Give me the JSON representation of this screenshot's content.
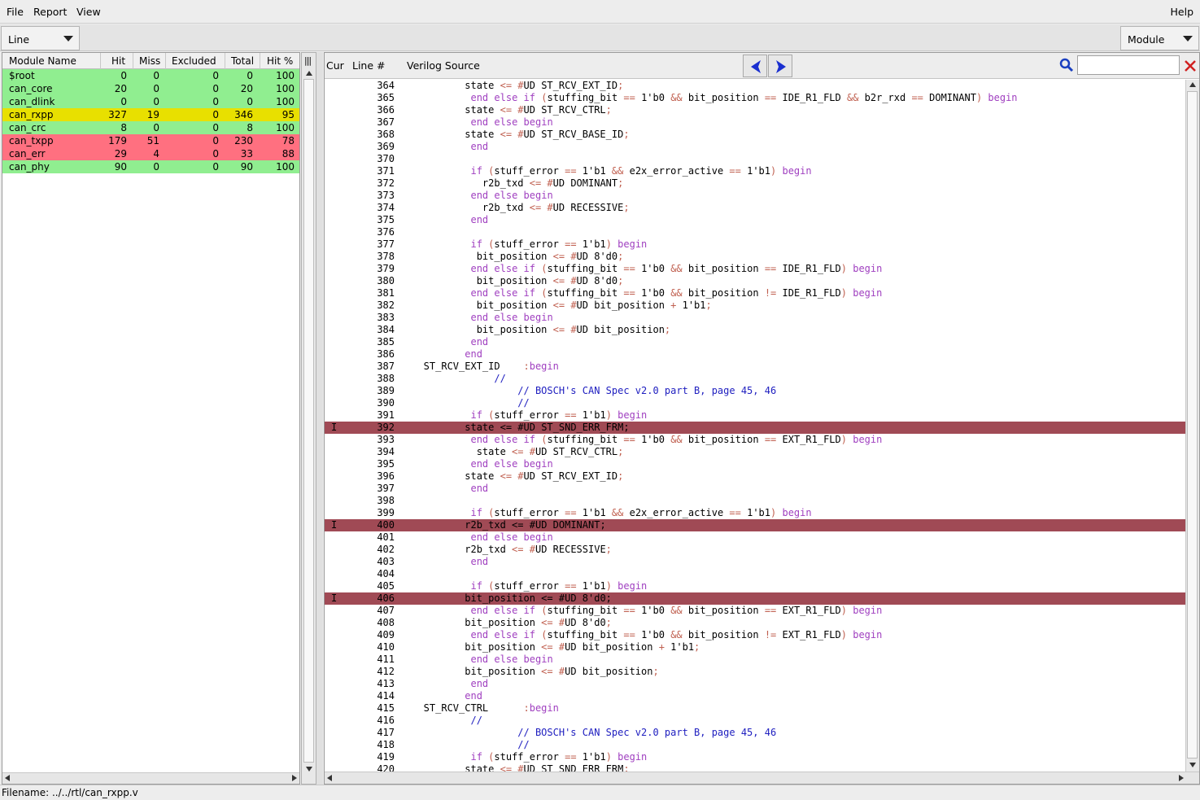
{
  "menu": {
    "file": "File",
    "report": "Report",
    "view": "View",
    "help": "Help"
  },
  "toolbar": {
    "coverage_type": "Line",
    "scope": "Module"
  },
  "module_table": {
    "columns": [
      "Module Name",
      "Hit",
      "Miss",
      "Excluded",
      "Total",
      "Hit %"
    ],
    "colors": {
      "full": "#90ee90",
      "partial": "#e8e000",
      "low": "#ff7080"
    },
    "rows": [
      {
        "name": "$root",
        "hit": "0",
        "miss": "0",
        "excluded": "0",
        "total": "0",
        "pct": "100",
        "status": "full"
      },
      {
        "name": "can_core",
        "hit": "20",
        "miss": "0",
        "excluded": "0",
        "total": "20",
        "pct": "100",
        "status": "full"
      },
      {
        "name": "can_dlink",
        "hit": "0",
        "miss": "0",
        "excluded": "0",
        "total": "0",
        "pct": "100",
        "status": "full"
      },
      {
        "name": "can_rxpp",
        "hit": "327",
        "miss": "19",
        "excluded": "0",
        "total": "346",
        "pct": "95",
        "status": "partial"
      },
      {
        "name": "can_crc",
        "hit": "8",
        "miss": "0",
        "excluded": "0",
        "total": "8",
        "pct": "100",
        "status": "full"
      },
      {
        "name": "can_txpp",
        "hit": "179",
        "miss": "51",
        "excluded": "0",
        "total": "230",
        "pct": "78",
        "status": "low"
      },
      {
        "name": "can_err",
        "hit": "29",
        "miss": "4",
        "excluded": "0",
        "total": "33",
        "pct": "88",
        "status": "low"
      },
      {
        "name": "can_phy",
        "hit": "90",
        "miss": "0",
        "excluded": "0",
        "total": "90",
        "pct": "100",
        "status": "full"
      }
    ]
  },
  "source": {
    "headers": {
      "cur": "Cur",
      "line": "Line #",
      "source": "Verilog Source"
    },
    "miss_color": "#a04a55",
    "lines": [
      {
        "n": "364",
        "code": "          state <= #UD ST_RCV_EXT_ID;"
      },
      {
        "n": "365",
        "code": "           end else if (stuffing_bit == 1'b0 && bit_position == IDE_R1_FLD && b2r_rxd == DOMINANT) begin"
      },
      {
        "n": "366",
        "code": "          state <= #UD ST_RCV_CTRL;"
      },
      {
        "n": "367",
        "code": "           end else begin"
      },
      {
        "n": "368",
        "code": "          state <= #UD ST_RCV_BASE_ID;"
      },
      {
        "n": "369",
        "code": "           end"
      },
      {
        "n": "370",
        "code": ""
      },
      {
        "n": "371",
        "code": "           if (stuff_error == 1'b1 && e2x_error_active == 1'b1) begin"
      },
      {
        "n": "372",
        "code": "             r2b_txd <= #UD DOMINANT;"
      },
      {
        "n": "373",
        "code": "           end else begin"
      },
      {
        "n": "374",
        "code": "             r2b_txd <= #UD RECESSIVE;"
      },
      {
        "n": "375",
        "code": "           end"
      },
      {
        "n": "376",
        "code": ""
      },
      {
        "n": "377",
        "code": "           if (stuff_error == 1'b1) begin"
      },
      {
        "n": "378",
        "code": "            bit_position <= #UD 8'd0;"
      },
      {
        "n": "379",
        "code": "           end else if (stuffing_bit == 1'b0 && bit_position == IDE_R1_FLD) begin"
      },
      {
        "n": "380",
        "code": "            bit_position <= #UD 8'd0;"
      },
      {
        "n": "381",
        "code": "           end else if (stuffing_bit == 1'b0 && bit_position != IDE_R1_FLD) begin"
      },
      {
        "n": "382",
        "code": "            bit_position <= #UD bit_position + 1'b1;"
      },
      {
        "n": "383",
        "code": "           end else begin"
      },
      {
        "n": "384",
        "code": "            bit_position <= #UD bit_position;"
      },
      {
        "n": "385",
        "code": "           end"
      },
      {
        "n": "386",
        "code": "          end"
      },
      {
        "n": "387",
        "code": "   ST_RCV_EXT_ID    :begin"
      },
      {
        "n": "388",
        "code": "               //"
      },
      {
        "n": "389",
        "code": "                   // BOSCH's CAN Spec v2.0 part B, page 45, 46"
      },
      {
        "n": "390",
        "code": "                   //"
      },
      {
        "n": "391",
        "code": "           if (stuff_error == 1'b1) begin"
      },
      {
        "n": "392",
        "code": "          state <= #UD ST_SND_ERR_FRM;",
        "cur": "I",
        "miss": true
      },
      {
        "n": "393",
        "code": "           end else if (stuffing_bit == 1'b0 && bit_position == EXT_R1_FLD) begin"
      },
      {
        "n": "394",
        "code": "            state <= #UD ST_RCV_CTRL;"
      },
      {
        "n": "395",
        "code": "           end else begin"
      },
      {
        "n": "396",
        "code": "          state <= #UD ST_RCV_EXT_ID;"
      },
      {
        "n": "397",
        "code": "           end"
      },
      {
        "n": "398",
        "code": ""
      },
      {
        "n": "399",
        "code": "           if (stuff_error == 1'b1 && e2x_error_active == 1'b1) begin"
      },
      {
        "n": "400",
        "code": "          r2b_txd <= #UD DOMINANT;",
        "cur": "I",
        "miss": true
      },
      {
        "n": "401",
        "code": "           end else begin"
      },
      {
        "n": "402",
        "code": "          r2b_txd <= #UD RECESSIVE;"
      },
      {
        "n": "403",
        "code": "           end"
      },
      {
        "n": "404",
        "code": ""
      },
      {
        "n": "405",
        "code": "           if (stuff_error == 1'b1) begin"
      },
      {
        "n": "406",
        "code": "          bit_position <= #UD 8'd0;",
        "cur": "I",
        "miss": true
      },
      {
        "n": "407",
        "code": "           end else if (stuffing_bit == 1'b0 && bit_position == EXT_R1_FLD) begin"
      },
      {
        "n": "408",
        "code": "          bit_position <= #UD 8'd0;"
      },
      {
        "n": "409",
        "code": "           end else if (stuffing_bit == 1'b0 && bit_position != EXT_R1_FLD) begin"
      },
      {
        "n": "410",
        "code": "          bit_position <= #UD bit_position + 1'b1;"
      },
      {
        "n": "411",
        "code": "           end else begin"
      },
      {
        "n": "412",
        "code": "          bit_position <= #UD bit_position;"
      },
      {
        "n": "413",
        "code": "           end"
      },
      {
        "n": "414",
        "code": "          end"
      },
      {
        "n": "415",
        "code": "   ST_RCV_CTRL      :begin"
      },
      {
        "n": "416",
        "code": "           //"
      },
      {
        "n": "417",
        "code": "                   // BOSCH's CAN Spec v2.0 part B, page 45, 46"
      },
      {
        "n": "418",
        "code": "                   //"
      },
      {
        "n": "419",
        "code": "           if (stuff_error == 1'b1) begin"
      },
      {
        "n": "420",
        "code": "          state <= #UD ST_SND_ERR_FRM;"
      }
    ]
  },
  "statusbar": {
    "filename": "Filename: ../../rtl/can_rxpp.v"
  }
}
